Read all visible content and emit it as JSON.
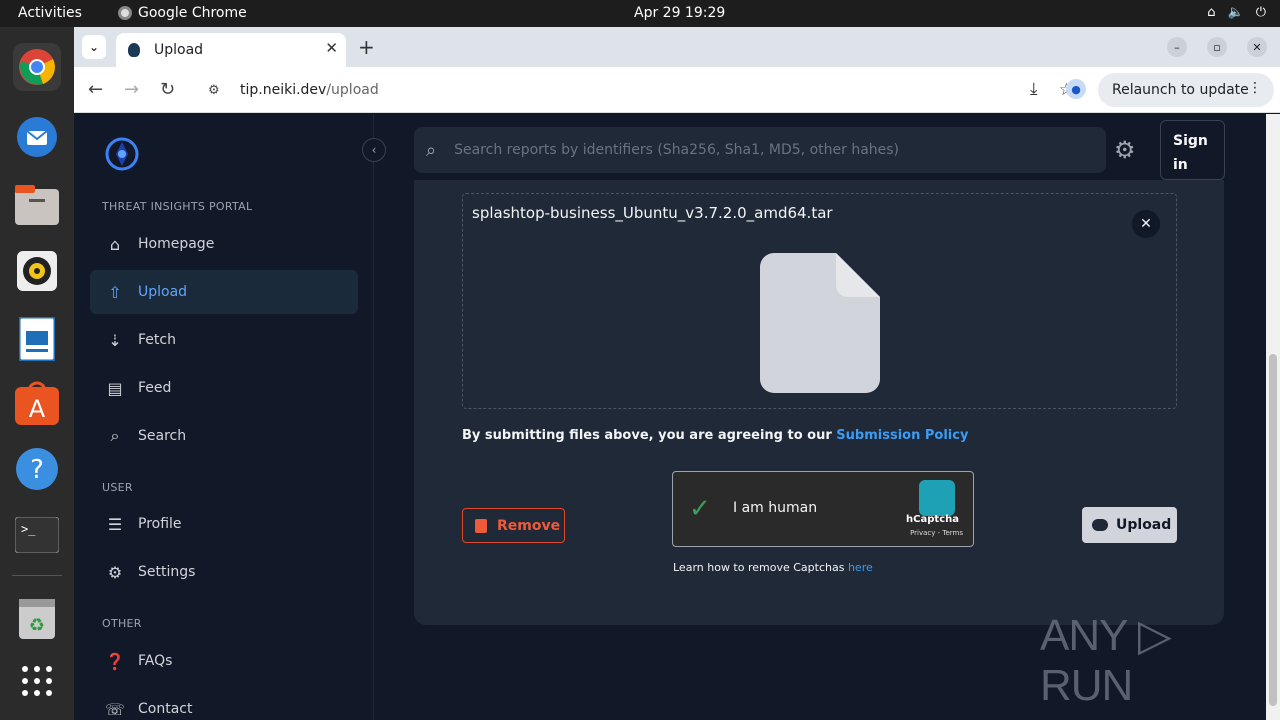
{
  "os": {
    "activities": "Activities",
    "app_name": "Google Chrome",
    "clock": "Apr 29  19:29"
  },
  "browser": {
    "tab_title": "Upload",
    "url_host": "tip.neiki.dev",
    "url_path": "/upload",
    "relaunch_label": "Relaunch to update"
  },
  "sidebar": {
    "section_portal": "THREAT INSIGHTS PORTAL",
    "section_user": "USER",
    "section_other": "OTHER",
    "items": [
      {
        "label": "Homepage"
      },
      {
        "label": "Upload"
      },
      {
        "label": "Fetch"
      },
      {
        "label": "Feed"
      },
      {
        "label": "Search"
      },
      {
        "label": "Profile"
      },
      {
        "label": "Settings"
      },
      {
        "label": "FAQs"
      },
      {
        "label": "Contact"
      }
    ]
  },
  "header": {
    "search_placeholder": "Search reports by identifiers (Sha256, Sha1, MD5, other hahes)",
    "signin_line1": "Sign",
    "signin_line2": "in"
  },
  "upload": {
    "filename": "splashtop-business_Ubuntu_v3.7.2.0_amd64.tar",
    "policy_text": "By submitting files above, you are agreeing to our ",
    "policy_link": "Submission Policy",
    "remove_label": "Remove",
    "upload_label": "Upload",
    "captcha_label": "I am human",
    "captcha_brand": "hCaptcha",
    "captcha_terms": "Privacy - Terms",
    "learn_text": "Learn how to remove Captchas ",
    "learn_link": "here"
  },
  "watermark": "ANY ▷ RUN",
  "colors": {
    "accent": "#3b9cf5",
    "danger": "#ef5b3a",
    "page_bg": "#111827",
    "card_bg": "#1f2937"
  }
}
